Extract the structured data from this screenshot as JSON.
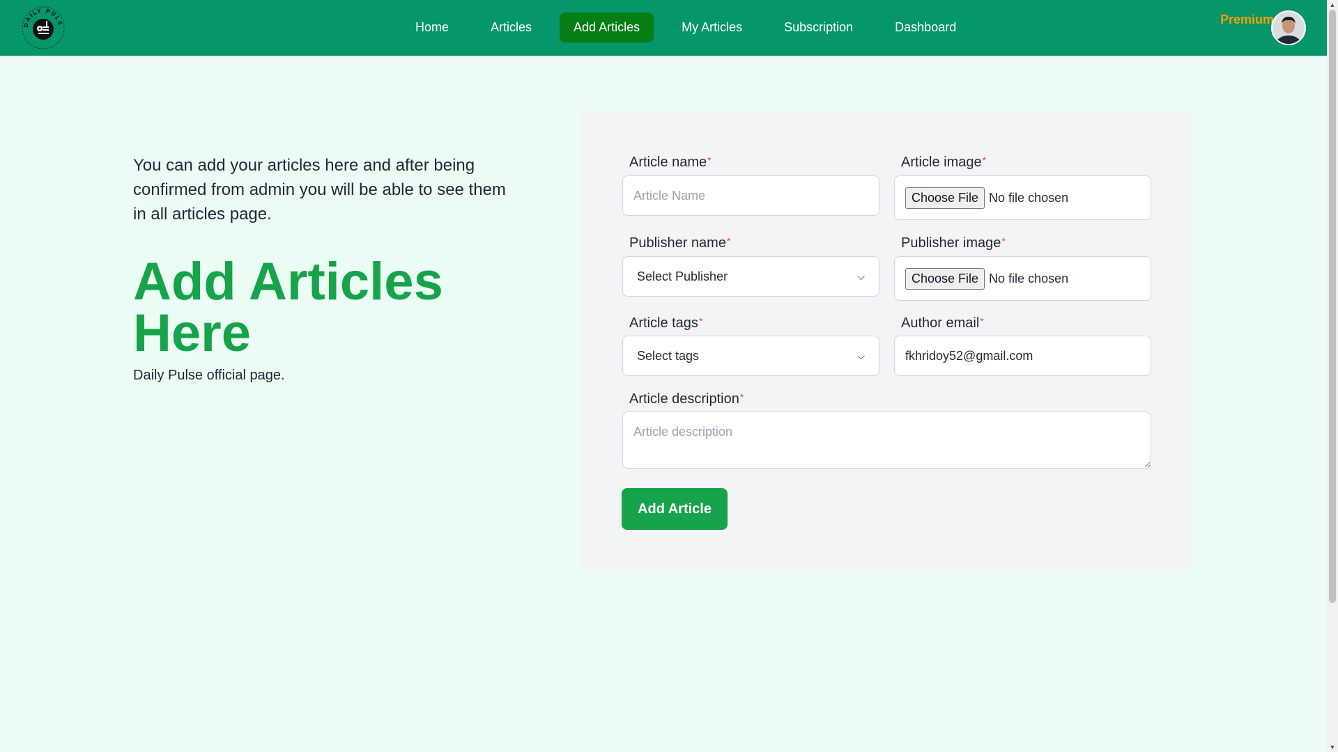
{
  "brand": {
    "logo_text": "DAILY PULSE",
    "logo_icon": "newspaper-pin-icon"
  },
  "nav": {
    "items": [
      {
        "label": "Home"
      },
      {
        "label": "Articles"
      },
      {
        "label": "Add Articles",
        "active": true
      },
      {
        "label": "My Articles"
      },
      {
        "label": "Subscription"
      },
      {
        "label": "Dashboard"
      }
    ],
    "premium_label": "Premium",
    "avatar_icon": "user-avatar-icon"
  },
  "intro": {
    "text": "You can add your articles here and after being confirmed from admin you will be able to see them in all articles page.",
    "title": "Add Articles Here",
    "subtitle": "Daily Pulse official page."
  },
  "form": {
    "required_mark": "*",
    "article_name": {
      "label": "Article name",
      "placeholder": "Article Name",
      "value": ""
    },
    "article_image": {
      "label": "Article image",
      "button": "Choose File",
      "status": "No file chosen"
    },
    "publisher_name": {
      "label": "Publisher name",
      "selected": "Select Publisher"
    },
    "publisher_image": {
      "label": "Publisher image",
      "button": "Choose File",
      "status": "No file chosen"
    },
    "article_tags": {
      "label": "Article tags",
      "selected": "Select tags"
    },
    "author_email": {
      "label": "Author email",
      "value": "fkhridoy52@gmail.com"
    },
    "article_description": {
      "label": "Article description",
      "placeholder": "Article description"
    },
    "submit_label": "Add Article"
  },
  "colors": {
    "navbar": "#059669",
    "active_nav": "#067d15",
    "accent_green": "#16a34a",
    "premium": "#f59e0b",
    "page_bg": "#eafcf3",
    "card_bg": "#f3f4f6"
  }
}
